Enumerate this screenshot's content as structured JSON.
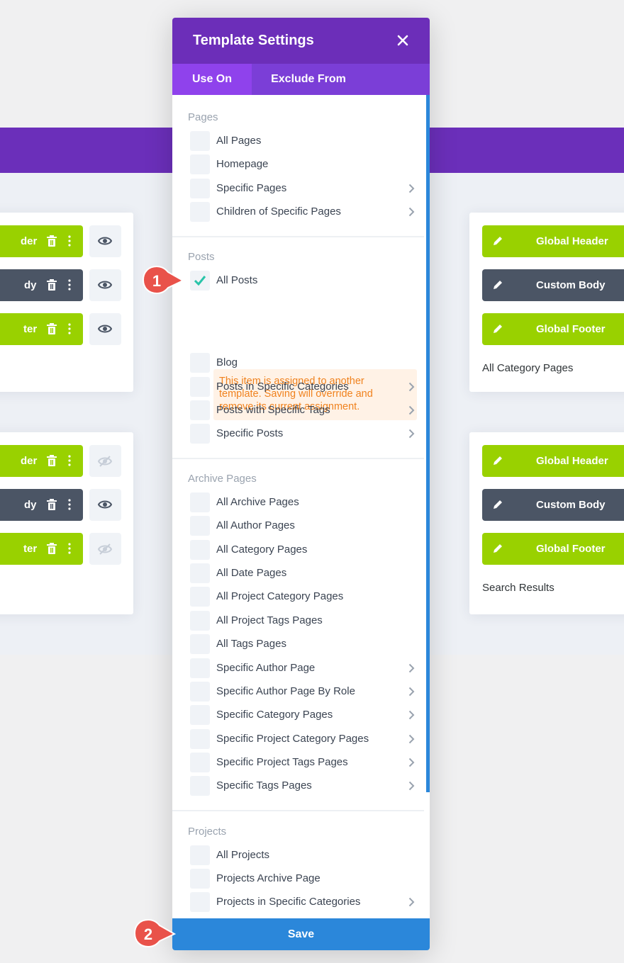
{
  "modal": {
    "title": "Template Settings",
    "tabs": [
      {
        "label": "Use On",
        "active": true
      },
      {
        "label": "Exclude From",
        "active": false
      }
    ],
    "groups": [
      {
        "title": "Pages",
        "options": [
          {
            "label": "All Pages",
            "checked": false,
            "has_submenu": false
          },
          {
            "label": "Homepage",
            "checked": false,
            "has_submenu": false
          },
          {
            "label": "Specific Pages",
            "checked": false,
            "has_submenu": true
          },
          {
            "label": "Children of Specific Pages",
            "checked": false,
            "has_submenu": true
          }
        ]
      },
      {
        "title": "Posts",
        "options": [
          {
            "label": "All Posts",
            "checked": true,
            "has_submenu": false
          },
          {
            "label": "Blog",
            "checked": false,
            "has_submenu": false
          },
          {
            "label": "Posts in Specific Categories",
            "checked": false,
            "has_submenu": true
          },
          {
            "label": "Posts with Specific Tags",
            "checked": false,
            "has_submenu": true
          },
          {
            "label": "Specific Posts",
            "checked": false,
            "has_submenu": true
          }
        ],
        "warning_lines": [
          "This item is assigned to another",
          "template. Saving will override and",
          "remove its current assignment."
        ]
      },
      {
        "title": "Archive Pages",
        "options": [
          {
            "label": "All Archive Pages",
            "checked": false,
            "has_submenu": false
          },
          {
            "label": "All Author Pages",
            "checked": false,
            "has_submenu": false
          },
          {
            "label": "All Category Pages",
            "checked": false,
            "has_submenu": false
          },
          {
            "label": "All Date Pages",
            "checked": false,
            "has_submenu": false
          },
          {
            "label": "All Project Category Pages",
            "checked": false,
            "has_submenu": false
          },
          {
            "label": "All Project Tags Pages",
            "checked": false,
            "has_submenu": false
          },
          {
            "label": "All Tags Pages",
            "checked": false,
            "has_submenu": false
          },
          {
            "label": "Specific Author Page",
            "checked": false,
            "has_submenu": true
          },
          {
            "label": "Specific Author Page By Role",
            "checked": false,
            "has_submenu": true
          },
          {
            "label": "Specific Category Pages",
            "checked": false,
            "has_submenu": true
          },
          {
            "label": "Specific Project Category Pages",
            "checked": false,
            "has_submenu": true
          },
          {
            "label": "Specific Project Tags Pages",
            "checked": false,
            "has_submenu": true
          },
          {
            "label": "Specific Tags Pages",
            "checked": false,
            "has_submenu": true
          }
        ]
      },
      {
        "title": "Projects",
        "options": [
          {
            "label": "All Projects",
            "checked": false,
            "has_submenu": false
          },
          {
            "label": "Projects Archive Page",
            "checked": false,
            "has_submenu": false
          },
          {
            "label": "Projects in Specific Categories",
            "checked": false,
            "has_submenu": true
          }
        ]
      }
    ],
    "save_label": "Save"
  },
  "background": {
    "left_cards": [
      {
        "buttons": [
          {
            "label": "der",
            "color": "#99d100",
            "visible": true
          },
          {
            "label": "dy",
            "color": "#4b5565",
            "visible": true
          },
          {
            "label": "ter",
            "color": "#99d100",
            "visible": true
          }
        ]
      },
      {
        "buttons": [
          {
            "label": "der",
            "color": "#99d100",
            "visible": false
          },
          {
            "label": "dy",
            "color": "#4b5565",
            "visible": true
          },
          {
            "label": "ter",
            "color": "#99d100",
            "visible": false
          }
        ]
      }
    ],
    "right_cards": [
      {
        "buttons": [
          {
            "label": "Global Header",
            "color": "#99d100"
          },
          {
            "label": "Custom Body",
            "color": "#4b5565"
          },
          {
            "label": "Global Footer",
            "color": "#99d100"
          }
        ],
        "caption": "All Category Pages"
      },
      {
        "buttons": [
          {
            "label": "Global Header",
            "color": "#99d100"
          },
          {
            "label": "Custom Body",
            "color": "#4b5565"
          },
          {
            "label": "Global Footer",
            "color": "#99d100"
          }
        ],
        "caption": "Search Results"
      }
    ]
  },
  "badges": [
    {
      "number": "1",
      "color": "#e9524a"
    },
    {
      "number": "2",
      "color": "#e9524a"
    }
  ],
  "colors": {
    "header_purple": "#6c2eb9",
    "tab_active": "#8f42ec",
    "save_blue": "#2b87da",
    "warning_text": "#f0821e",
    "warning_bg": "#fff2e6",
    "check_teal": "#29c4a9"
  }
}
